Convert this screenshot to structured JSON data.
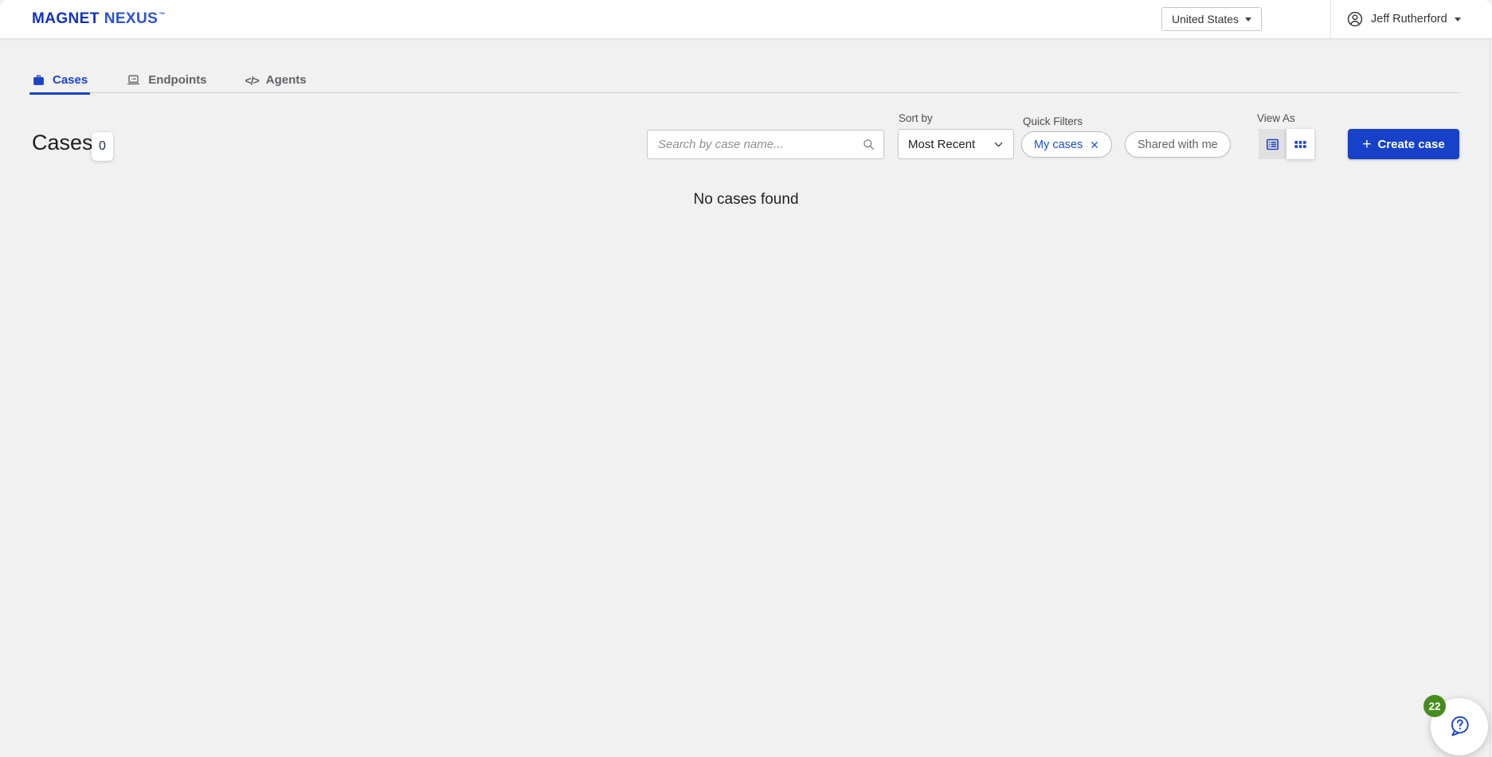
{
  "app": {
    "brand": "MAGNET",
    "product": "NEXUS",
    "trademark": "™"
  },
  "header": {
    "region_selector": {
      "value": "United States"
    },
    "user_menu": {
      "name": "Jeff Rutherford"
    }
  },
  "tabs": [
    {
      "label": "Cases",
      "icon": "briefcase-icon",
      "active": true
    },
    {
      "label": "Endpoints",
      "icon": "laptop-icon",
      "active": false
    },
    {
      "label": "Agents",
      "icon": "code-icon",
      "active": false
    }
  ],
  "toolbar": {
    "page_title": "Cases",
    "case_count": "0",
    "search_placeholder": "Search by case name...",
    "sort_label": "Sort by",
    "sort_value": "Most Recent",
    "quick_filters_label": "Quick Filters",
    "filter_chips": [
      {
        "label": "My cases",
        "removable": true,
        "state": "active"
      },
      {
        "label": "Shared with me",
        "removable": false,
        "state": "inactive"
      }
    ],
    "view_as_label": "View As",
    "view_options": [
      "list",
      "grid"
    ],
    "view_selected": "list",
    "create_case_plus": "+",
    "create_case_label": "Create case"
  },
  "content": {
    "empty_state_message": "No cases found"
  },
  "help_widget": {
    "unread_count": "22",
    "icon": "help-chat-icon"
  },
  "icons": [
    "briefcase-icon",
    "laptop-icon",
    "code-icon",
    "person-circle-icon",
    "caret-down-icon",
    "search-icon",
    "chevron-down-icon",
    "close-icon",
    "list-view-icon",
    "grid-view-icon",
    "plus-icon",
    "help-chat-icon"
  ],
  "colors": {
    "brand_blue": "#1232bd",
    "accent_blue": "#1a43c8",
    "button_blue": "#1641c8",
    "badge_green": "#478c1e",
    "page_background": "#f1f1f1"
  }
}
